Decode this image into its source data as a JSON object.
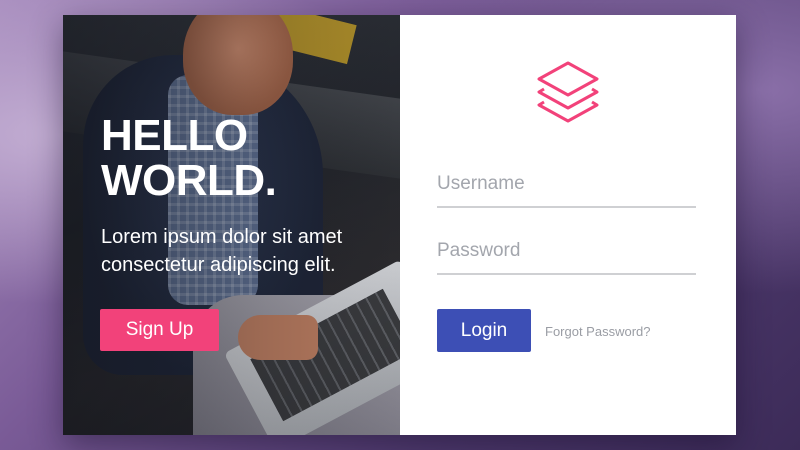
{
  "hero": {
    "headline_line1": "HELLO",
    "headline_line2": "WORLD.",
    "subtitle_line1": "Lorem ipsum dolor sit amet",
    "subtitle_line2": "consectetur adipiscing elit.",
    "signup_label": "Sign Up"
  },
  "form": {
    "logo_icon": "layers-stack-icon",
    "username_placeholder": "Username",
    "password_placeholder": "Password",
    "login_label": "Login",
    "forgot_label": "Forgot Password?"
  },
  "colors": {
    "accent_pink": "#f2427a",
    "accent_blue": "#3d4fb5",
    "logo_pink": "#f2427a"
  }
}
